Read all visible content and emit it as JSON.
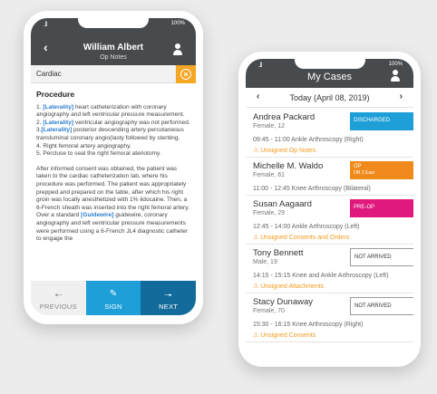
{
  "colors": {
    "header": "#474b4e",
    "accent_orange": "#f5a623",
    "sign": "#1e9fd8",
    "next": "#136b9b",
    "link": "#2b7bcf",
    "discharged": "#1e9fd8",
    "op": "#f08a1c",
    "preop": "#e0197d"
  },
  "status": {
    "signal": "..ll",
    "battery": "100%"
  },
  "opnotes": {
    "patient_name": "William Albert",
    "subtitle": "Op Notes",
    "back_icon": "chevron-left-icon",
    "search_value": "Cardiac",
    "heading": "Procedure",
    "steps": [
      {
        "num": "1.",
        "tag": "[Laterality]",
        "text": " heart catheterization with coronary angiography and left ventricular pressure measurement."
      },
      {
        "num": "2.",
        "tag": "[Laterality]",
        "text": " ventricular angiography was not performed."
      },
      {
        "num": "3.",
        "tag": "[Laterality]",
        "text": " posterior descending artery percutaneous transluminal coronary angio(lasty followed by stenting."
      },
      {
        "num": "4.",
        "tag": "",
        "text": "Right femoral artery angiography."
      },
      {
        "num": "5.",
        "tag": "",
        "text": "Percluse to seal the right femoral ateriotomy."
      }
    ],
    "para_a": "After informed consent was obtained, the patient was taken to the cardiac catheterization lab, where his procedure was performed. The patient was appropriately prepped and prepared on the table, after which his right groin was locally anesthetized with 1% lidocaine. Then, a 6-French sheath was inserted into the right femoral artery. Over a standard ",
    "para_tag": "[Guidewire]",
    "para_b": " guidewire, coronary angiography and left ventricular pressure measurements were performed using a 6-French JL4 diagnostic catheter to engage the",
    "nav": {
      "previous": "PREVIOUS",
      "sign": "SIGN",
      "next": "NEXT"
    }
  },
  "mycases": {
    "title": "My Cases",
    "date": "Today (April 08, 2019)",
    "cases": [
      {
        "name": "Andrea Packard",
        "gender_age": "Female, 12",
        "procedure": "09:45 - 11:00 Ankle Arthroscopy (Right)",
        "alert": "Unsigned Op Notes",
        "status": "DISCHARGED",
        "status_sub": "",
        "status_color": "#1e9fd8"
      },
      {
        "name": "Michelle M. Waldo",
        "gender_age": "Female, 61",
        "procedure": "11:00 - 12:45 Knee Arthroscopy (Bilateral)",
        "alert": "",
        "status": "OP",
        "status_sub": "OR 2 East",
        "status_color": "#f08a1c"
      },
      {
        "name": "Susan Aagaard",
        "gender_age": "Female, 29",
        "procedure": "12:45 - 14:00 Ankle Arthroscopy (Left)",
        "alert": "Unsigned Consents and Orders",
        "status": "PRE-OP",
        "status_sub": "",
        "status_color": "#e0197d"
      },
      {
        "name": "Tony Bennett",
        "gender_age": "Male, 19",
        "procedure": "14:15 - 15:15 Knee and Ankle Arthroscopy (Left)",
        "alert": "Unsigned Attachments",
        "status": "NOT ARRIVED",
        "status_sub": "",
        "status_color": "#ffffff"
      },
      {
        "name": "Stacy Dunaway",
        "gender_age": "Female, 70",
        "procedure": "15:30 - 16:15 Knee Arthroscopy (Right)",
        "alert": "Unsigned Consents",
        "status": "NOT ARRIVED",
        "status_sub": "",
        "status_color": "#ffffff"
      }
    ]
  }
}
